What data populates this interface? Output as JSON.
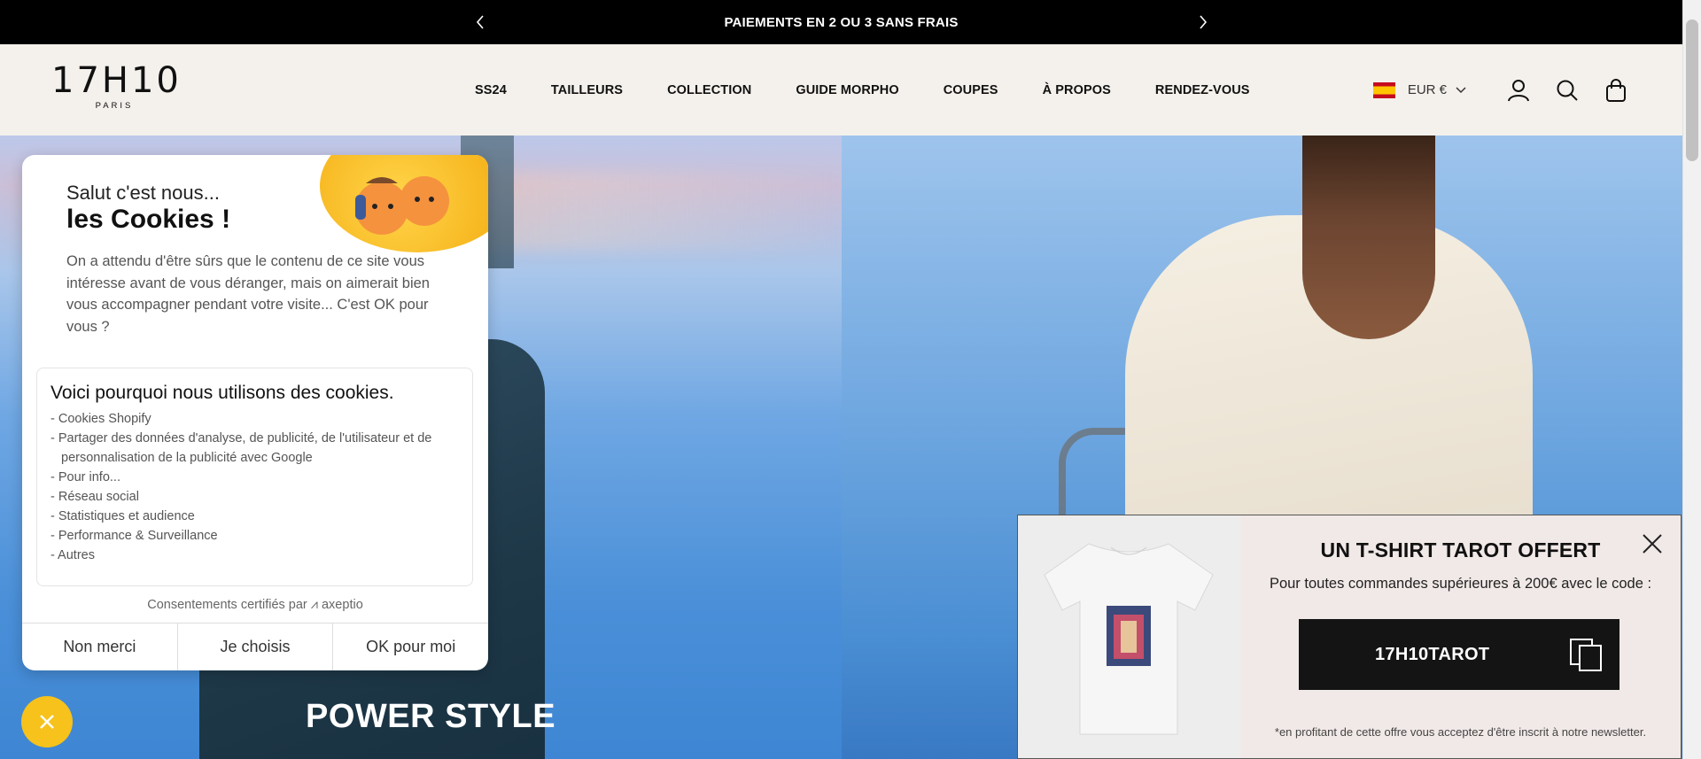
{
  "announcement": {
    "text": "PAIEMENTS EN 2 OU 3 SANS FRAIS"
  },
  "logo": {
    "main": "17H10",
    "sub": "PARIS"
  },
  "nav": {
    "items": [
      "SS24",
      "TAILLEURS",
      "COLLECTION",
      "GUIDE MORPHO",
      "COUPES",
      "À PROPOS",
      "RENDEZ-VOUS"
    ]
  },
  "header_tools": {
    "currency": "EUR €",
    "icons": [
      "spain-flag-icon",
      "account-icon",
      "search-icon",
      "cart-icon"
    ]
  },
  "hero": {
    "title": "POWER STYLE"
  },
  "cookie": {
    "greeting": "Salut c'est nous...",
    "heading": "les Cookies !",
    "description": "On a attendu d'être sûrs que le contenu de ce site vous intéresse avant de vous déranger, mais on aimerait bien vous accompagner pendant votre visite... C'est OK pour vous ?",
    "box_title": "Voici pourquoi nous utilisons des cookies.",
    "reasons": [
      "- Cookies Shopify",
      "- Partager des données d'analyse, de publicité, de l'utilisateur et de personnalisation de la publicité avec Google",
      "- Pour info...",
      "- Réseau social",
      "- Statistiques et audience",
      "- Performance & Surveillance",
      "- Autres"
    ],
    "certified": "Consentements certifiés par ⩘ axeptio",
    "buttons": {
      "refuse": "Non merci",
      "choose": "Je choisis",
      "accept": "OK pour moi"
    }
  },
  "promo": {
    "title": "UN T-SHIRT TAROT OFFERT",
    "text": "Pour toutes commandes supérieures à 200€ avec le code :",
    "code": "17H10TAROT",
    "note": "*en profitant de cette offre vous acceptez d'être inscrit à notre newsletter."
  },
  "colors": {
    "accent": "#f6c21b",
    "dark": "#141414",
    "header_bg": "#f4f1ec",
    "promo_bg": "#f1e9e7"
  }
}
